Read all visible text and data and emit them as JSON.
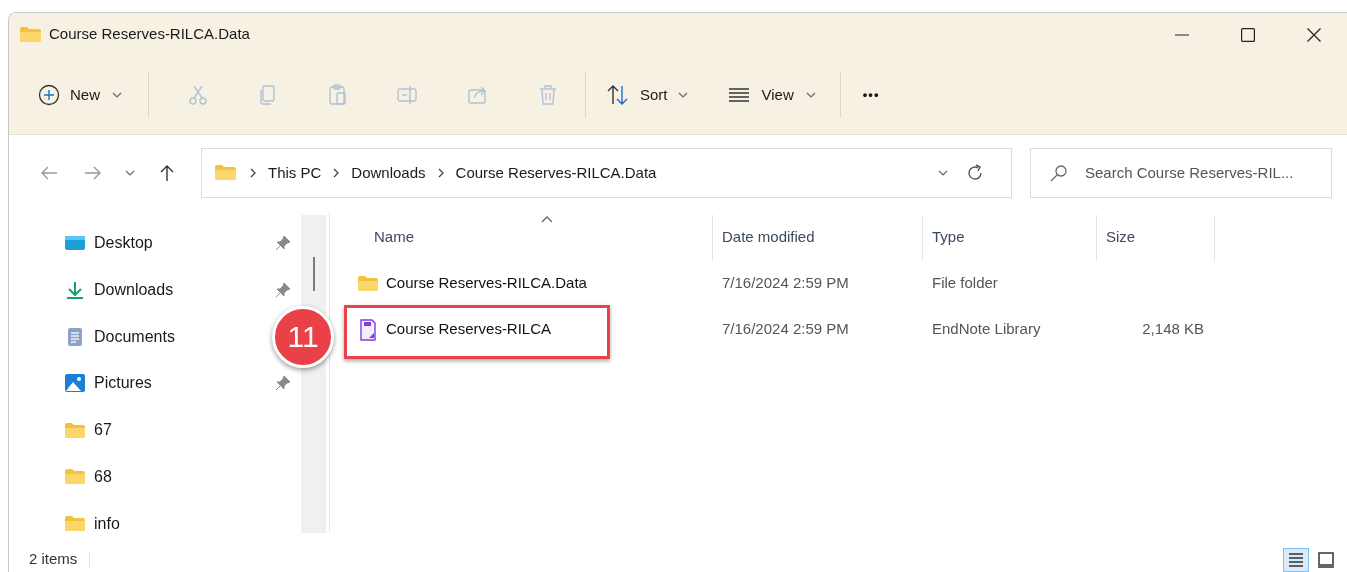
{
  "window": {
    "title": "Course Reserves-RILCA.Data"
  },
  "toolbar": {
    "new": "New",
    "actions": [
      {
        "kind": "cut",
        "disabled": true
      },
      {
        "kind": "copy",
        "disabled": true
      },
      {
        "kind": "paste",
        "disabled": true
      },
      {
        "kind": "rename",
        "disabled": true
      },
      {
        "kind": "share",
        "disabled": true
      },
      {
        "kind": "delete",
        "disabled": true
      }
    ],
    "sort": "Sort",
    "view": "View",
    "more": "•••"
  },
  "address": {
    "crumbs": [
      "This PC",
      "Downloads",
      "Course Reserves-RILCA.Data"
    ],
    "search_placeholder": "Search Course Reserves-RIL..."
  },
  "sidebar": {
    "items": [
      {
        "label": "Desktop",
        "kind": "desktop",
        "pinned": true
      },
      {
        "label": "Downloads",
        "kind": "download",
        "pinned": true
      },
      {
        "label": "Documents",
        "kind": "document",
        "pinned": false
      },
      {
        "label": "Pictures",
        "kind": "pictures",
        "pinned": true
      },
      {
        "label": "67",
        "kind": "folder",
        "pinned": false
      },
      {
        "label": "68",
        "kind": "folder",
        "pinned": false
      },
      {
        "label": "info",
        "kind": "folder",
        "pinned": false
      }
    ]
  },
  "table": {
    "columns": [
      "Name",
      "Date modified",
      "Type",
      "Size"
    ],
    "rows": [
      {
        "name": "Course Reserves-RILCA.Data",
        "kind": "folder",
        "date": "7/16/2024 2:59 PM",
        "type": "File folder",
        "highlighted": false
      },
      {
        "name": "Course Reserves-RILCA",
        "kind": "endnote",
        "date": "7/16/2024 2:59 PM",
        "type": "EndNote Library",
        "size": "2,148 KB",
        "highlighted": true
      }
    ]
  },
  "step_badge": "11",
  "status_bar": {
    "count": "2 items",
    "views": [
      {
        "kind": "details",
        "selected": true
      },
      {
        "kind": "tiles",
        "selected": false
      }
    ]
  }
}
